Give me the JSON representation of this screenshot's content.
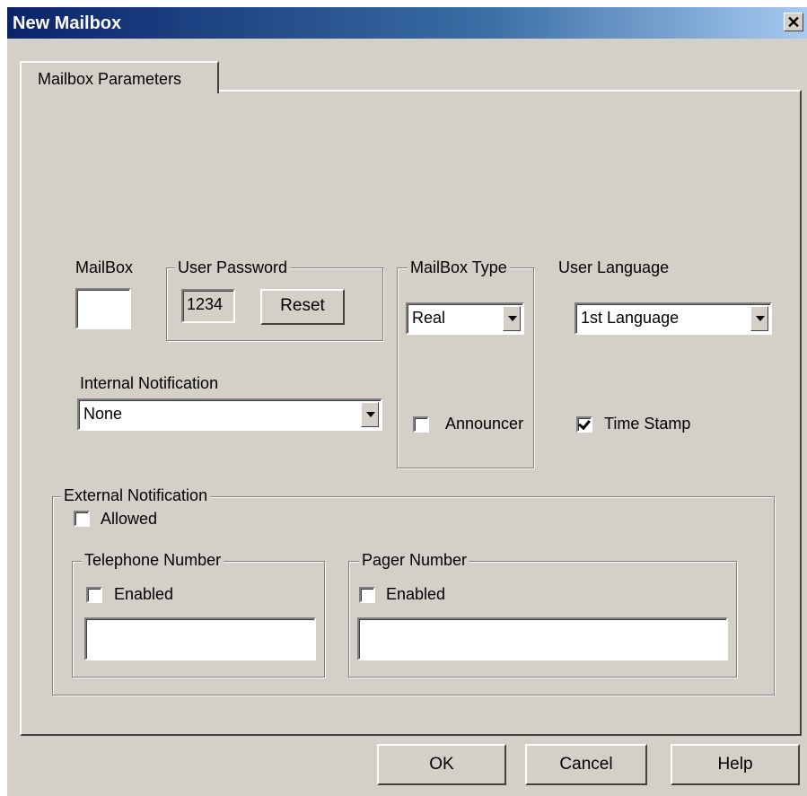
{
  "window": {
    "title": "New Mailbox",
    "close_glyph": "✕"
  },
  "tab": {
    "label": "Mailbox Parameters"
  },
  "mailbox": {
    "label": "MailBox",
    "value": ""
  },
  "user_password": {
    "legend": "User Password",
    "value": "1234",
    "reset_label": "Reset"
  },
  "mailbox_type": {
    "legend": "MailBox Type",
    "value": "Real",
    "announcer_label": "Announcer",
    "announcer_checked": false
  },
  "user_language": {
    "label": "User Language",
    "value": "1st Language"
  },
  "internal_notification": {
    "label": "Internal Notification",
    "value": "None"
  },
  "time_stamp": {
    "label": "Time Stamp",
    "checked": true
  },
  "external_notification": {
    "legend": "External Notification",
    "allowed_label": "Allowed",
    "allowed_checked": false,
    "telephone": {
      "legend": "Telephone Number",
      "enabled_label": "Enabled",
      "enabled_checked": false,
      "value": ""
    },
    "pager": {
      "legend": "Pager Number",
      "enabled_label": "Enabled",
      "enabled_checked": false,
      "value": ""
    }
  },
  "buttons": {
    "ok": "OK",
    "cancel": "Cancel",
    "help": "Help"
  }
}
